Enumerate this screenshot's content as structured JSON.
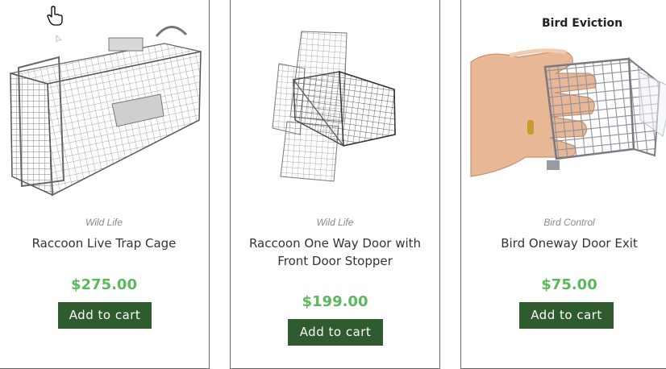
{
  "products": [
    {
      "category": "Wild Life",
      "title": "Raccoon Live Trap Cage",
      "price": "$275.00",
      "button": "Add to cart",
      "image_caption": ""
    },
    {
      "category": "Wild Life",
      "title": "Raccoon One Way Door with Front Door Stopper",
      "price": "$199.00",
      "button": "Add to cart",
      "image_caption": ""
    },
    {
      "category": "Bird Control",
      "title": "Bird Oneway Door Exit",
      "price": "$75.00",
      "button": "Add to cart",
      "image_caption": "Bird Eviction"
    }
  ],
  "colors": {
    "price": "#5cb85c",
    "button_bg": "#2f5c2f",
    "button_text": "#ffffff",
    "border": "#6a6a6a"
  },
  "icons": [
    "hand-pointer-cursor-icon",
    "arrow-cursor-icon"
  ]
}
